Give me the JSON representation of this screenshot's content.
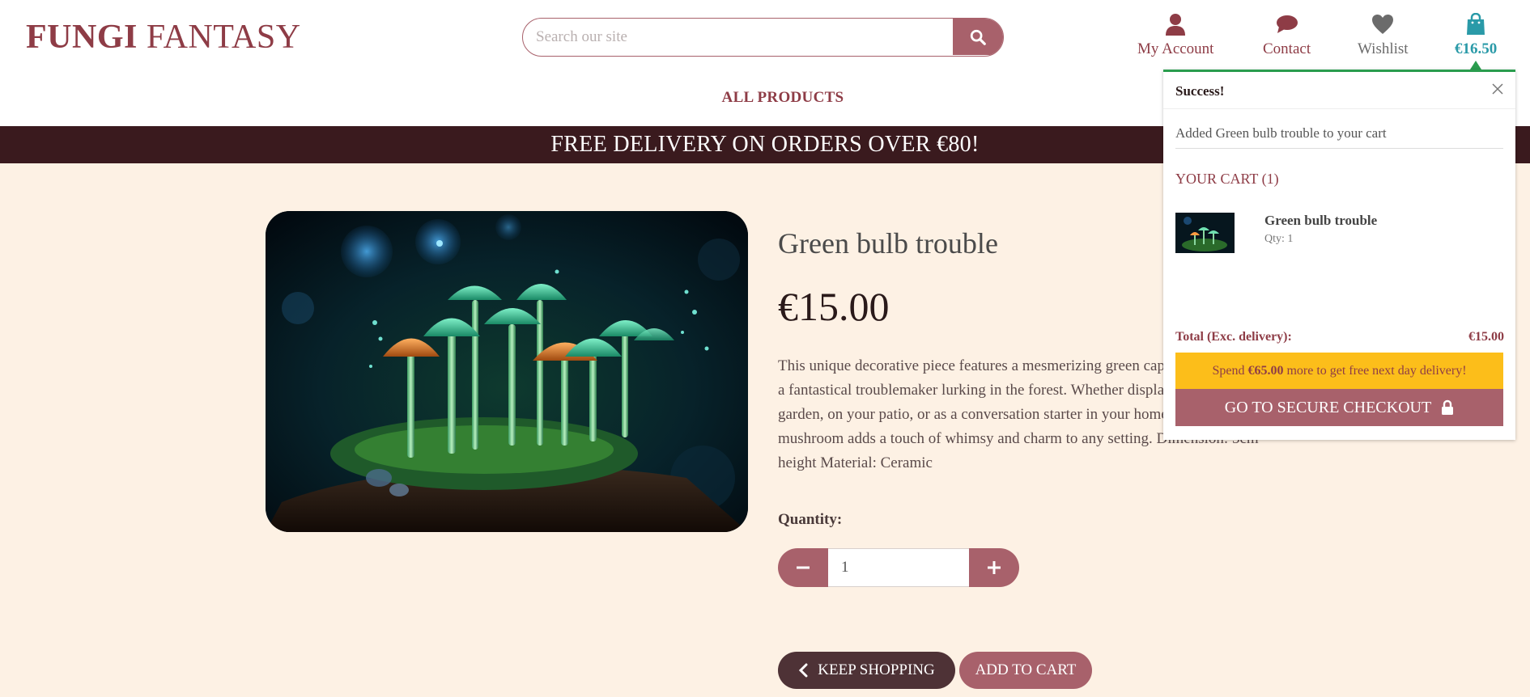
{
  "header": {
    "logo_bold": "FUNGI",
    "logo_rest": "FANTASY",
    "search_placeholder": "Search our site",
    "nav": {
      "account": "My Account",
      "contact": "Contact",
      "wishlist": "Wishlist",
      "cart_total": "€16.50"
    },
    "menu": {
      "all_products": "ALL PRODUCTS"
    }
  },
  "banner": {
    "text": "FREE DELIVERY ON ORDERS OVER €80!"
  },
  "product": {
    "title": "Green bulb trouble",
    "price": "€15.00",
    "description": "This unique decorative piece features a mesmerizing green cap, reminiscent of a fantastical troublemaker lurking in the forest. Whether displayed in your garden, on your patio, or as a conversation starter in your home, this mushroom adds a touch of whimsy and charm to any setting. Dimension: 5cm height Material: Ceramic",
    "quantity_label": "Quantity:",
    "quantity_value": "1",
    "keep_shopping": "KEEP SHOPPING",
    "add_to_cart": "ADD TO CART"
  },
  "cart_popup": {
    "title": "Success!",
    "message": "Added Green bulb trouble to your cart",
    "cart_heading": "YOUR CART (1)",
    "item_name": "Green bulb trouble",
    "item_qty": "Qty: 1",
    "total_label": "Total (Exc. delivery):",
    "total_value": "€15.00",
    "spend_prefix": "Spend ",
    "spend_amount": "€65.00",
    "spend_suffix": " more to get free next day delivery!",
    "checkout": "GO TO SECURE CHECKOUT"
  },
  "colors": {
    "brand": "#8e3c46",
    "accent": "#a8616b",
    "banner_bg": "#3a1a1e",
    "page_bg": "#fdf1e4",
    "cart_total": "#2a9aa8",
    "success_border": "#2a9d4e",
    "notice": "#fcbe1a"
  },
  "icons": [
    "search-icon",
    "user-icon",
    "chat-bubble-icon",
    "heart-icon",
    "shopping-bag-icon",
    "close-icon",
    "minus-icon",
    "plus-icon",
    "chevron-left-icon",
    "lock-icon"
  ]
}
